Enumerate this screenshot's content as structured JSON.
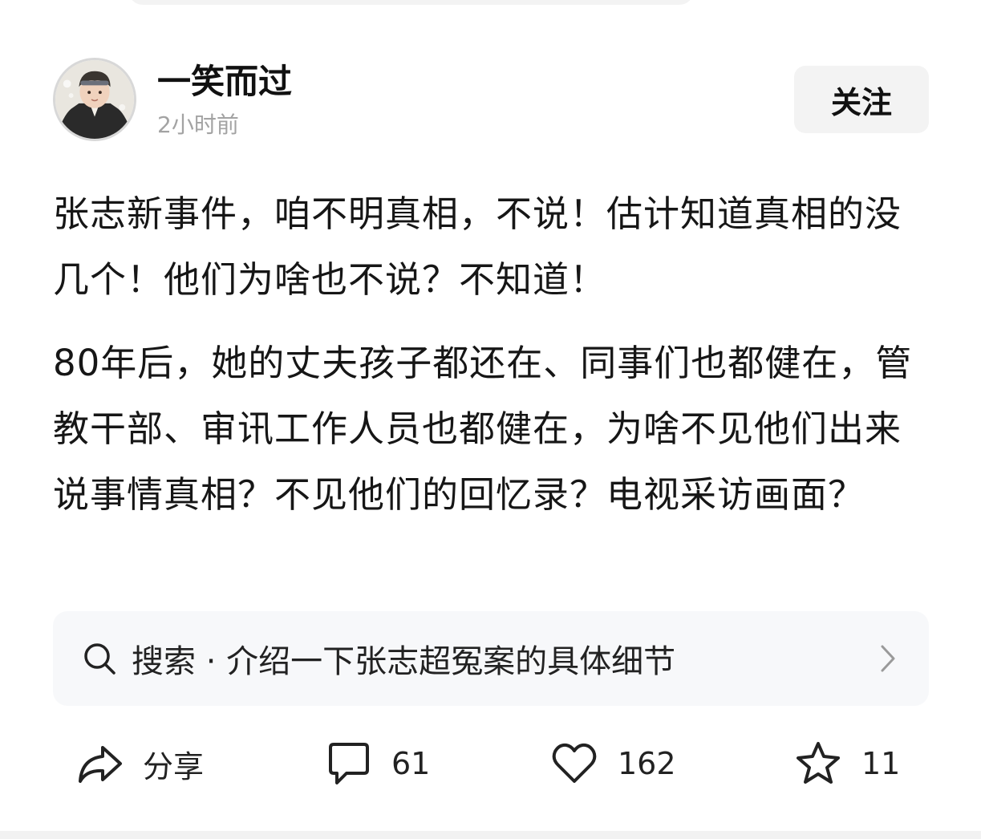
{
  "author": {
    "name": "一笑而过",
    "time": "2小时前",
    "follow_label": "关注"
  },
  "post": {
    "paragraphs": [
      "张志新事件，咱不明真相，不说！估计知道真相的没几个！他们为啥也不说？不知道！",
      "80年后，她的丈夫孩子都还在、同事们也都健在，管教干部、审讯工作人员也都健在，为啥不见他们出来说事情真相？不见他们的回忆录？电视采访画面？"
    ]
  },
  "search_suggestion": {
    "text": "搜索 · 介绍一下张志超冤案的具体细节"
  },
  "actions": {
    "share_label": "分享",
    "comments": "61",
    "likes": "162",
    "favorites": "11"
  },
  "colors": {
    "text": "#161616",
    "muted": "#a3a3a3",
    "button_bg": "#f3f3f3",
    "card_bg": "#f7f8fa"
  },
  "icons": [
    "avatar",
    "search-icon",
    "chevron-right-icon",
    "share-icon",
    "comment-icon",
    "heart-icon",
    "star-icon"
  ]
}
